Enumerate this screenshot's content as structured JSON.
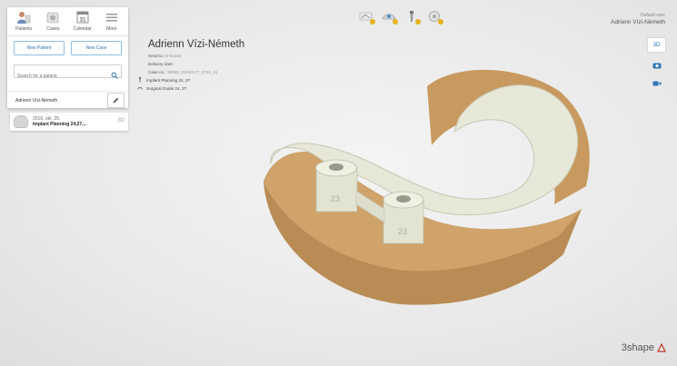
{
  "toolbar": {
    "items": [
      {
        "label": "Patients",
        "icon": "patients-icon"
      },
      {
        "label": "Cases",
        "icon": "cases-icon"
      },
      {
        "label": "Calendar",
        "icon": "calendar-icon"
      },
      {
        "label": "More",
        "icon": "more-icon"
      }
    ],
    "calendar_day": "31"
  },
  "actions": {
    "new_patient": "New Patient",
    "new_case": "New Case"
  },
  "search": {
    "placeholder": "Search for a patient"
  },
  "selected_patient": {
    "name": "Adrienn Vízi-Németh"
  },
  "case_card": {
    "date": "2016. okt. 25.",
    "title": "Implant Planning 24,27,...",
    "badge": "3D"
  },
  "case_info": {
    "title": "Adrienn Vízi-Németh",
    "send_to_label": "Send to:",
    "send_to_value": "In-house",
    "delivery_label": "Delivery date:",
    "delivery_value": "",
    "case_no_label": "Case no.:",
    "case_no_value": "39998_2016OCT_0751_01",
    "items": [
      "Implant Planning 24, 27",
      "Surgical Guide 24, 27"
    ]
  },
  "user": {
    "label": "Default user",
    "name": "Adrienn Vízi-Németh"
  },
  "view_mode": "3D",
  "guide_labels": [
    "23",
    "23"
  ],
  "brand": "3shape",
  "colors": {
    "accent": "#2f74b5",
    "stone": "#c8a36e",
    "guide": "#e9e9dc",
    "check": "#e7b31d"
  }
}
